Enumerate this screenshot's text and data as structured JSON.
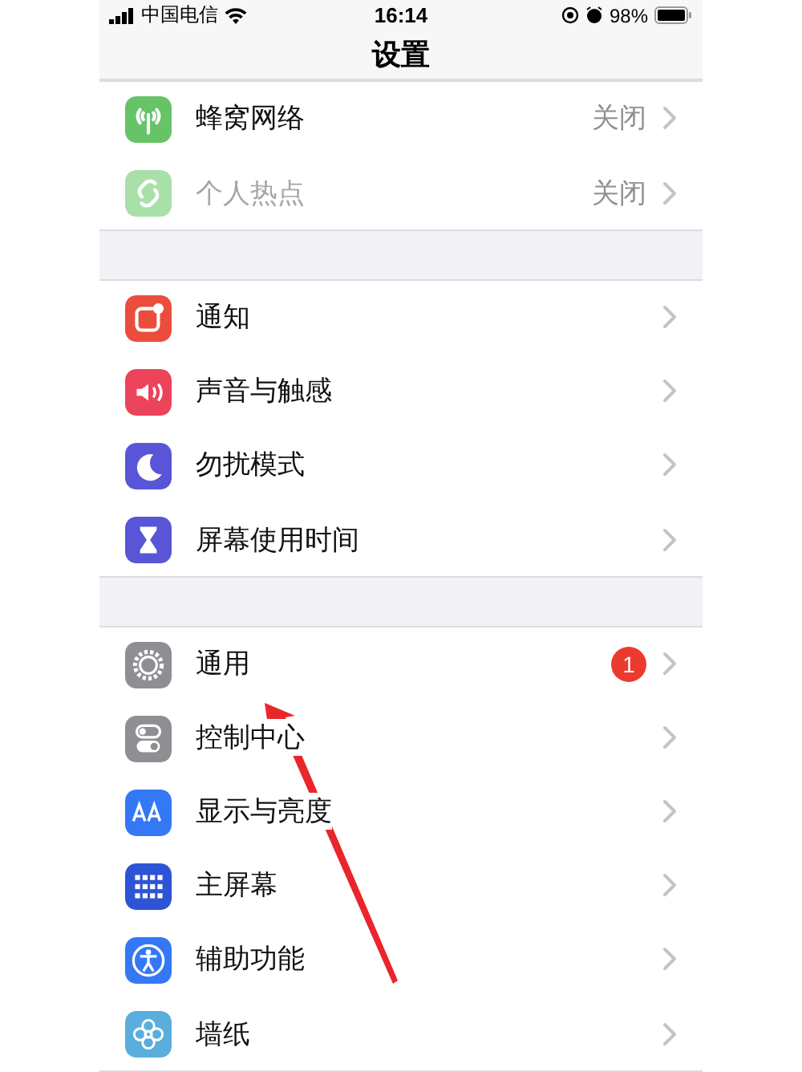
{
  "status_bar": {
    "carrier": "中国电信",
    "time": "16:14",
    "battery": "98%"
  },
  "nav": {
    "title": "设置"
  },
  "groups": [
    {
      "rows": [
        {
          "label": "蜂窝网络",
          "value": "关闭",
          "kind": "antenna",
          "color": "#65c466",
          "disabled": false
        },
        {
          "label": "个人热点",
          "value": "关闭",
          "kind": "link",
          "color": "#a9dfa9",
          "disabled": true
        }
      ]
    },
    {
      "rows": [
        {
          "label": "通知",
          "kind": "notification",
          "color": "#eb4d3d",
          "disabled": false
        },
        {
          "label": "声音与触感",
          "kind": "sound",
          "color": "#eb445a",
          "disabled": false
        },
        {
          "label": "勿扰模式",
          "kind": "moon",
          "color": "#5856d6",
          "disabled": false
        },
        {
          "label": "屏幕使用时间",
          "kind": "hourglass",
          "color": "#5856d6",
          "disabled": false
        }
      ]
    },
    {
      "rows": [
        {
          "label": "通用",
          "badge": "1",
          "kind": "gear",
          "color": "#8e8e93",
          "disabled": false
        },
        {
          "label": "控制中心",
          "kind": "toggles",
          "color": "#8e8e93",
          "disabled": false
        },
        {
          "label": "显示与亮度",
          "kind": "text",
          "color": "#3478f6",
          "disabled": false
        },
        {
          "label": "主屏幕",
          "kind": "grid",
          "color": "#2e54d6",
          "disabled": false
        },
        {
          "label": "辅助功能",
          "kind": "accessibility",
          "color": "#3478f6",
          "disabled": false
        },
        {
          "label": "墙纸",
          "kind": "flower",
          "color": "#5aaede",
          "disabled": false
        }
      ]
    }
  ],
  "annotations": [
    {
      "kind": "arrow"
    }
  ]
}
